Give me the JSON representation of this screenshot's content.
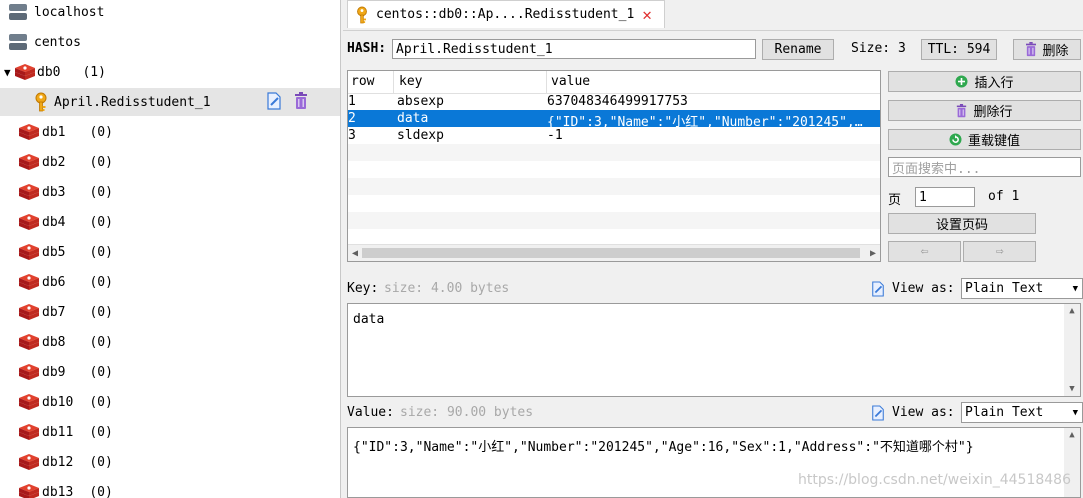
{
  "tree": {
    "servers": [
      {
        "label": "localhost"
      },
      {
        "label": "centos"
      }
    ],
    "db0": {
      "label": "db0",
      "count": "(1)"
    },
    "key_item": {
      "label": "April.Redisstudent_1"
    },
    "dbs": [
      {
        "label": "db1",
        "count": "(0)"
      },
      {
        "label": "db2",
        "count": "(0)"
      },
      {
        "label": "db3",
        "count": "(0)"
      },
      {
        "label": "db4",
        "count": "(0)"
      },
      {
        "label": "db5",
        "count": "(0)"
      },
      {
        "label": "db6",
        "count": "(0)"
      },
      {
        "label": "db7",
        "count": "(0)"
      },
      {
        "label": "db8",
        "count": "(0)"
      },
      {
        "label": "db9",
        "count": "(0)"
      },
      {
        "label": "db10",
        "count": "(0)"
      },
      {
        "label": "db11",
        "count": "(0)"
      },
      {
        "label": "db12",
        "count": "(0)"
      },
      {
        "label": "db13",
        "count": "(0)"
      }
    ]
  },
  "tab": {
    "title": "centos::db0::Ap....Redisstudent_1",
    "close": "✕"
  },
  "key_bar": {
    "type_label": "HASH:",
    "key_name": "April.Redisstudent_1",
    "rename": "Rename",
    "size": "Size: 3",
    "ttl": "TTL: 594",
    "delete": "删除"
  },
  "table": {
    "headers": [
      "row",
      "key",
      "value"
    ],
    "rows": [
      {
        "row": "1",
        "key": "absexp",
        "value": "637048346499917753"
      },
      {
        "row": "2",
        "key": "data",
        "value": "{\"ID\":3,\"Name\":\"小红\",\"Number\":\"201245\",…"
      },
      {
        "row": "3",
        "key": "sldexp",
        "value": "-1"
      }
    ],
    "selected_index": 1
  },
  "side_actions": {
    "add_row": "插入行",
    "delete_row": "删除行",
    "reload": "重载键值",
    "search_placeholder": "页面搜索中...",
    "page_label": "页",
    "page_value": "1",
    "page_of": "of 1",
    "set_page": "设置页码",
    "prev": "⇦",
    "next": "⇨"
  },
  "key_editor": {
    "label": "Key:",
    "size_hint": "size: 4.00 bytes",
    "view_as": "View as:",
    "format": "Plain Text",
    "content": "data"
  },
  "value_editor": {
    "label": "Value:",
    "size_hint": "size: 90.00 bytes",
    "view_as": "View as:",
    "format": "Plain Text",
    "content": "{\"ID\":3,\"Name\":\"小红\",\"Number\":\"201245\",\"Age\":16,\"Sex\":1,\"Address\":\"不知道哪个村\"}"
  },
  "watermark": "https://blog.csdn.net/weixin_44518486",
  "colors": {
    "selection": "#0a78d7",
    "key_icon": "#f0a818",
    "redis_red": "#c8201c",
    "delete_purple": "#8a5ac8"
  }
}
